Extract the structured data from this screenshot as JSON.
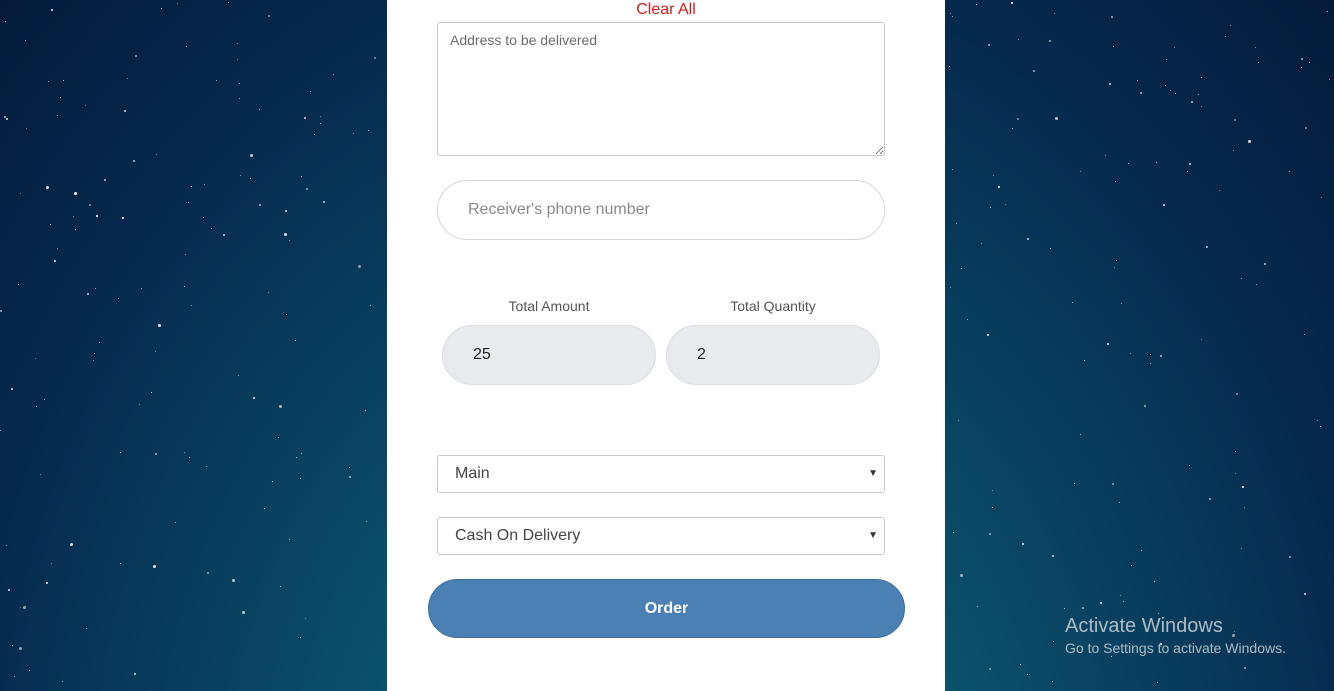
{
  "form": {
    "clear_all_label": "Clear All",
    "address_placeholder": "Address to be delivered",
    "phone_placeholder": "Receiver's phone number",
    "total_amount_label": "Total Amount",
    "total_amount_value": "25",
    "total_quantity_label": "Total Quantity",
    "total_quantity_value": "2",
    "location_select_value": "Main",
    "payment_select_value": "Cash On Delivery",
    "order_button_label": "Order"
  },
  "os_watermark": {
    "title": "Activate Windows",
    "subtitle": "Go to Settings to activate Windows."
  },
  "colors": {
    "clear_all": "#d21c1c",
    "order_button": "#4a80b3",
    "readonly_field_bg": "#e8eaed",
    "background_top": "#041a3a",
    "background_bottom": "#0f6f7e"
  },
  "icons": {
    "select_caret": "chevron-down-icon",
    "textarea_resize": "resize-grip-icon"
  }
}
